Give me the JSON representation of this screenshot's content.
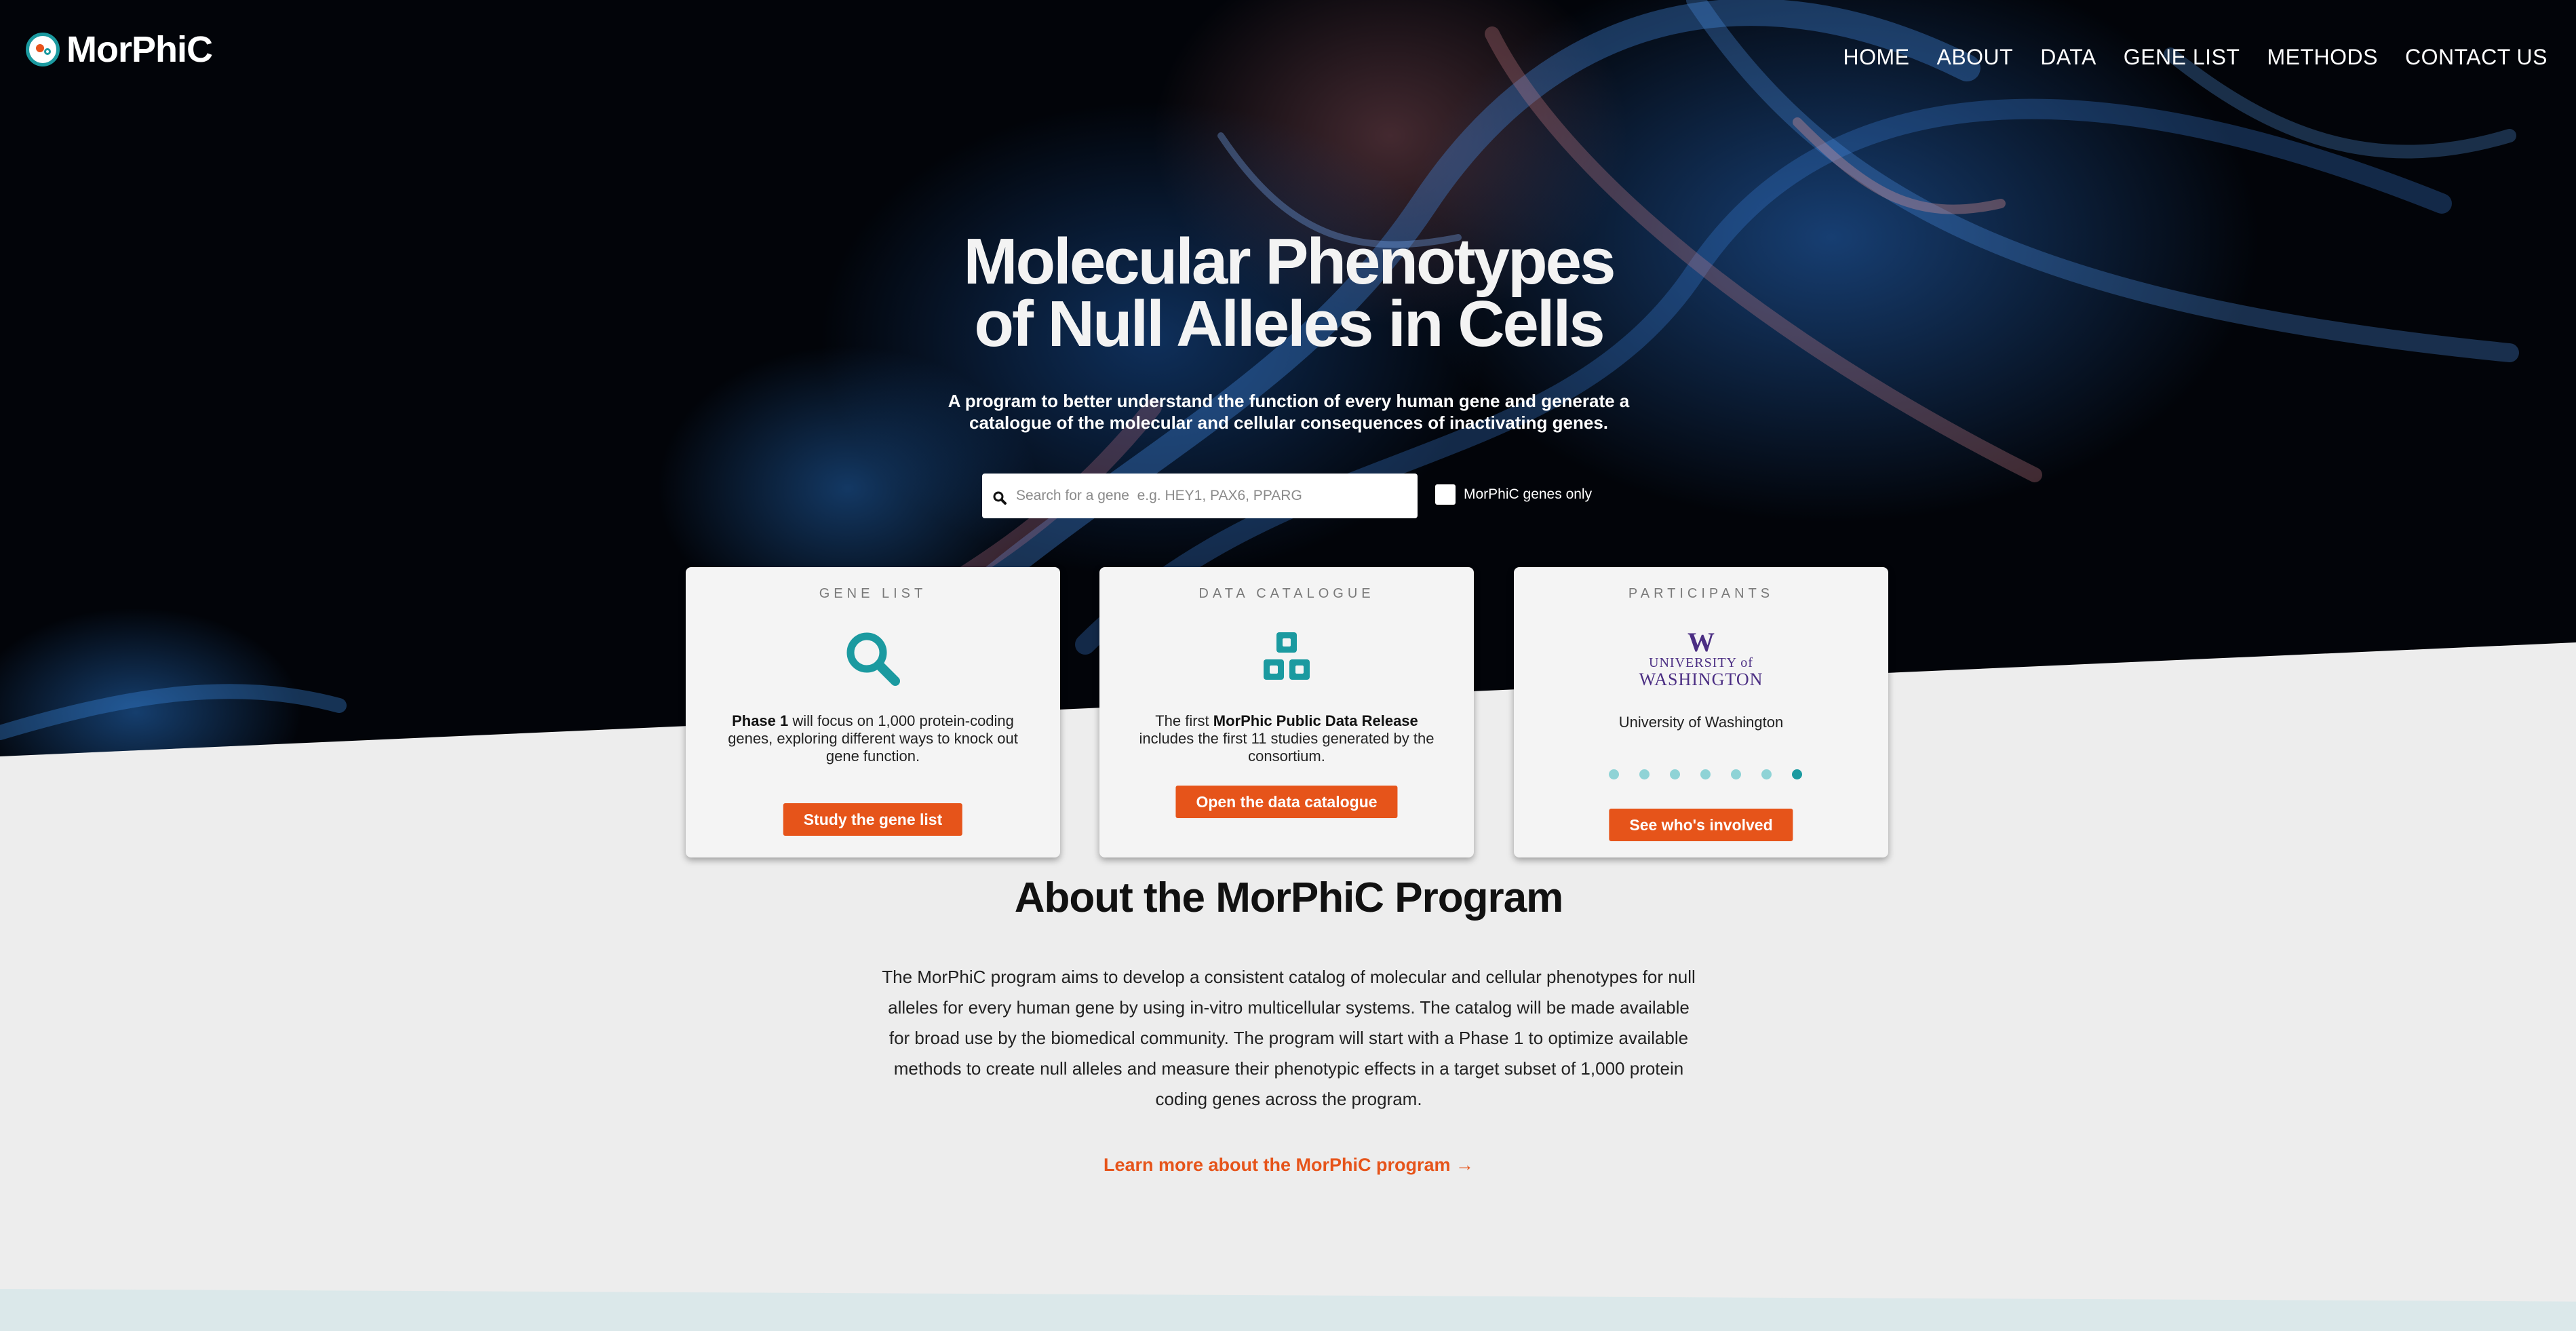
{
  "brand": {
    "name": "MorPhiC"
  },
  "nav": [
    {
      "label": "HOME"
    },
    {
      "label": "ABOUT"
    },
    {
      "label": "DATA"
    },
    {
      "label": "GENE LIST"
    },
    {
      "label": "METHODS"
    },
    {
      "label": "CONTACT US"
    }
  ],
  "hero": {
    "title_line1": "Molecular Phenotypes",
    "title_line2": "of Null Alleles in Cells",
    "subtitle_line1": "A program to better understand the function of every human gene and generate a",
    "subtitle_line2": "catalogue of the molecular and cellular consequences of inactivating genes."
  },
  "search": {
    "placeholder": "Search for a gene  e.g. HEY1, PAX6, PPARG",
    "value": "",
    "checkbox_label": "MorPhiC genes only",
    "checkbox_checked": false
  },
  "cards": [
    {
      "title": "GENE LIST",
      "icon": "magnifier-icon",
      "text_bold": "Phase 1",
      "text_rest": " will focus on 1,000 protein-coding genes, exploring different ways to knock out gene function.",
      "button": "Study the gene list"
    },
    {
      "title": "DATA CATALOGUE",
      "icon": "stacked-boxes-icon",
      "text_before": "The first ",
      "text_bold": "MorPhic Public Data Release",
      "text_after": " includes the first 11 studies generated by the consortium.",
      "button": "Open the data catalogue"
    },
    {
      "title": "PARTICIPANTS",
      "logo_w": "W",
      "logo_line1": "UNIVERSITY of",
      "logo_line2": "WASHINGTON",
      "caption": "University of Washington",
      "carousel_count": 7,
      "carousel_active": 7,
      "button": "See who's involved"
    }
  ],
  "about": {
    "title": "About the MorPhiC Program",
    "body": "The MorPhiC program aims to develop a consistent catalog of molecular and cellular phenotypes for null alleles for every human gene by using in-vitro multicellular systems. The catalog will be made available for broad use by the biomedical community. The program will start with a Phase 1 to optimize available methods to create null alleles and measure their phenotypic effects in a target subset of 1,000 protein coding genes across the program.",
    "link": "Learn more about the MorPhiC program →"
  },
  "colors": {
    "accent": "#e6541a",
    "teal": "#1b9aa0",
    "uw_purple": "#4b2e83",
    "page_bg": "#ededed"
  }
}
